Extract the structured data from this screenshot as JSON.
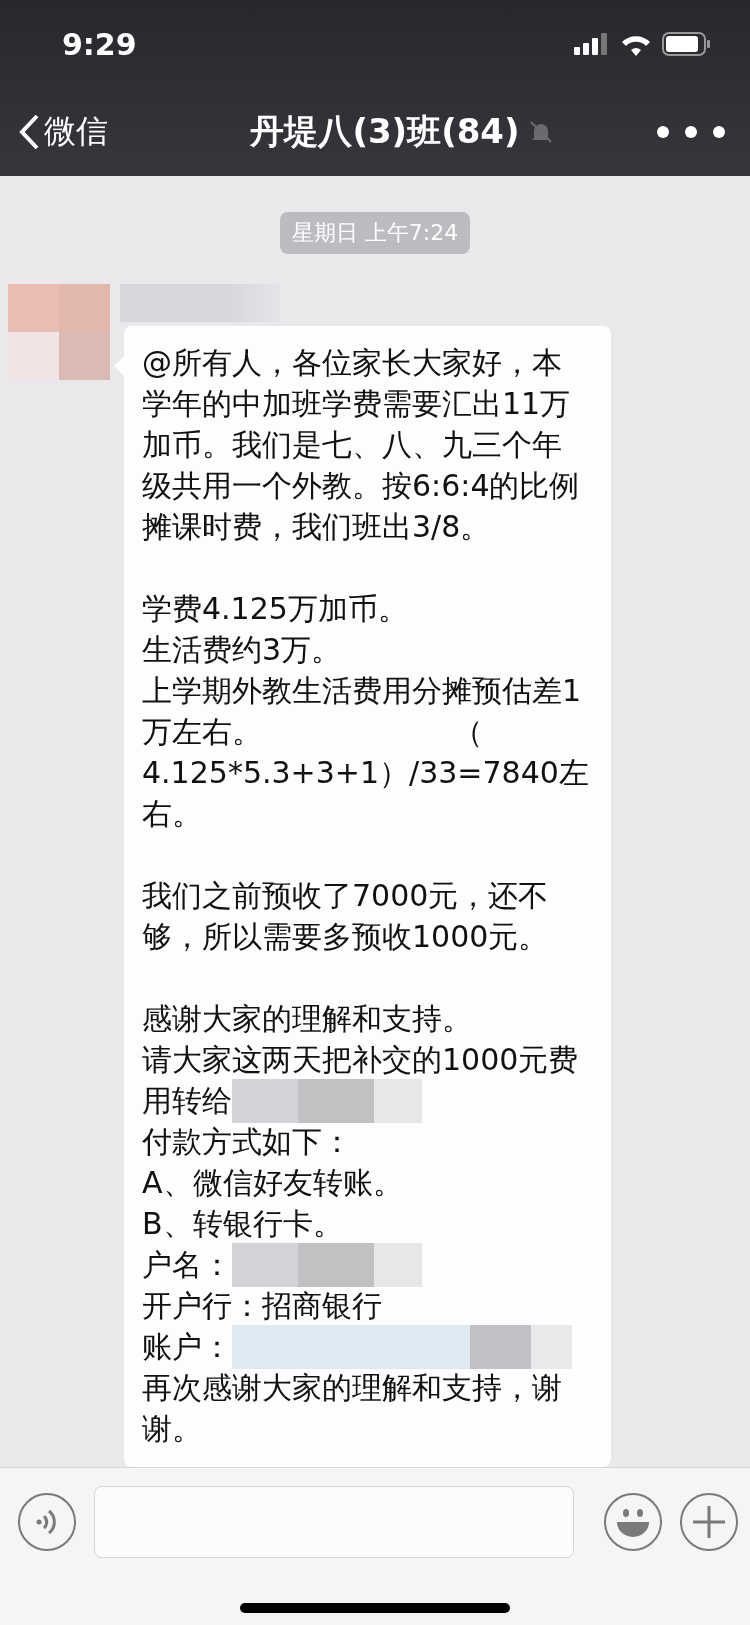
{
  "status_bar": {
    "time": "9:29"
  },
  "nav": {
    "back": "微信",
    "title": "丹堤八(3)班(84)",
    "muted": true
  },
  "chat": {
    "timestamp": "星期日 上午7:24",
    "message": {
      "paragraphs": [
        [
          {
            "text": "@所有人，各位家长大家好，本"
          },
          {
            "text": "学年的中加班学费需要汇出11万"
          },
          {
            "text": "加币。我们是七、八、九三个年"
          },
          {
            "text": "级共用一个外教。按6:6:4的比例"
          },
          {
            "text": "摊课时费，我们班出3/8。"
          }
        ],
        [
          {
            "text": "学费4.125万加币。"
          },
          {
            "text": "生活费约3万。"
          },
          {
            "text": "上学期外教生活费用分摊预估差1"
          },
          {
            "text": "万左右。                    （"
          },
          {
            "text": "4.125*5.3+3+1）/33=7840左"
          },
          {
            "text": "右。"
          }
        ],
        [
          {
            "text": "我们之前预收了7000元，还不"
          },
          {
            "text": "够，所以需要多预收1000元。"
          }
        ],
        [
          {
            "text": "感谢大家的理解和支持。"
          },
          {
            "text": "请大家这两天把补交的1000元费"
          },
          {
            "text": "用转给",
            "redacted": true,
            "tinted": false
          },
          {
            "text": "付款方式如下："
          },
          {
            "text": "A、微信好友转账。"
          },
          {
            "text": "B、转银行卡。"
          },
          {
            "text": "户名：",
            "redacted": true,
            "tinted": false
          },
          {
            "text": "开户行：招商银行"
          },
          {
            "text": "账户：",
            "redacted": true,
            "tinted": true
          },
          {
            "text": "再次感谢大家的理解和支持，谢"
          },
          {
            "text": "谢。"
          }
        ]
      ]
    }
  }
}
